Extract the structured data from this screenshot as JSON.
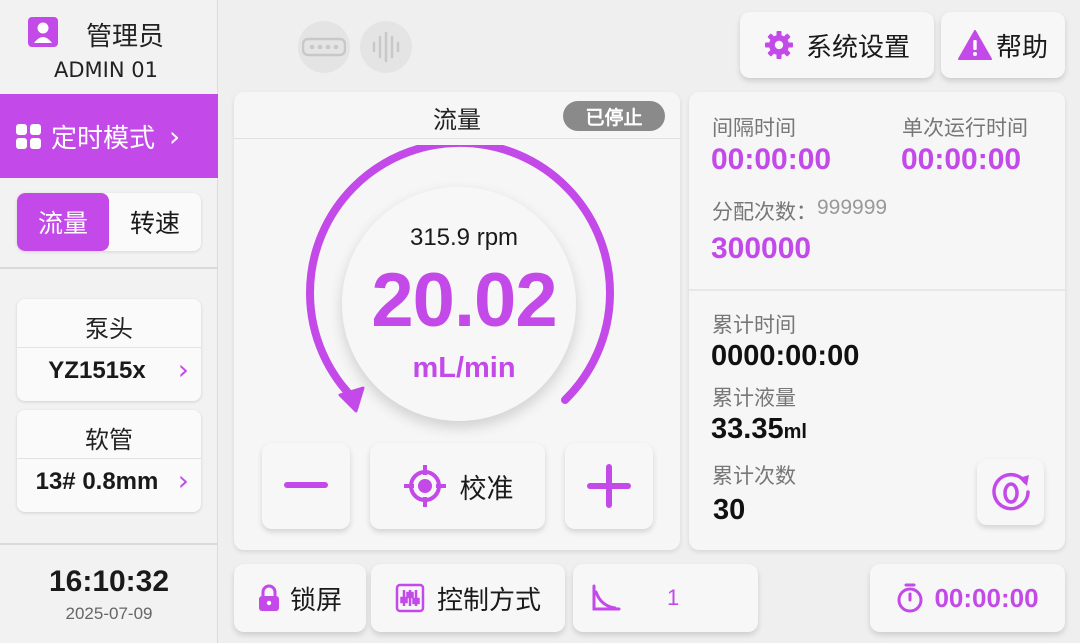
{
  "user": {
    "role": "管理员",
    "name": "ADMIN 01"
  },
  "mode": {
    "label": "定时模式"
  },
  "toggle": {
    "flow": "流量",
    "speed": "转速"
  },
  "pump_head": {
    "title": "泵头",
    "value": "YZ1515x"
  },
  "tubing": {
    "title": "软管",
    "value": "13# 0.8mm"
  },
  "clock": {
    "time": "16:10:32",
    "date": "2025-07-09"
  },
  "header": {
    "settings_label": "系统设置",
    "help_label": "帮助"
  },
  "main": {
    "title": "流量",
    "status": "已停止",
    "rpm": "315.9 rpm",
    "flow_value": "20.02",
    "flow_unit": "mL/min",
    "calibrate_label": "校准"
  },
  "timing": {
    "interval_label": "间隔时间",
    "interval_value": "00:00:00",
    "single_run_label": "单次运行时间",
    "single_run_value": "00:00:00",
    "dispense_label": "分配次数：",
    "dispense_max": "999999",
    "dispense_value": "300000"
  },
  "cumulative": {
    "time_label": "累计时间",
    "time_value": "0000:00:00",
    "volume_label": "累计液量",
    "volume_value": "33.35",
    "volume_unit": "ml",
    "count_label": "累计次数",
    "count_value": "30"
  },
  "bottom": {
    "lock_label": "锁屏",
    "control_label": "控制方式",
    "ramp_value": "1",
    "timer_value": "00:00:00"
  },
  "colors": {
    "accent": "#c34ae8",
    "stopped_badge": "#8a8a8a",
    "background": "#efefef"
  }
}
